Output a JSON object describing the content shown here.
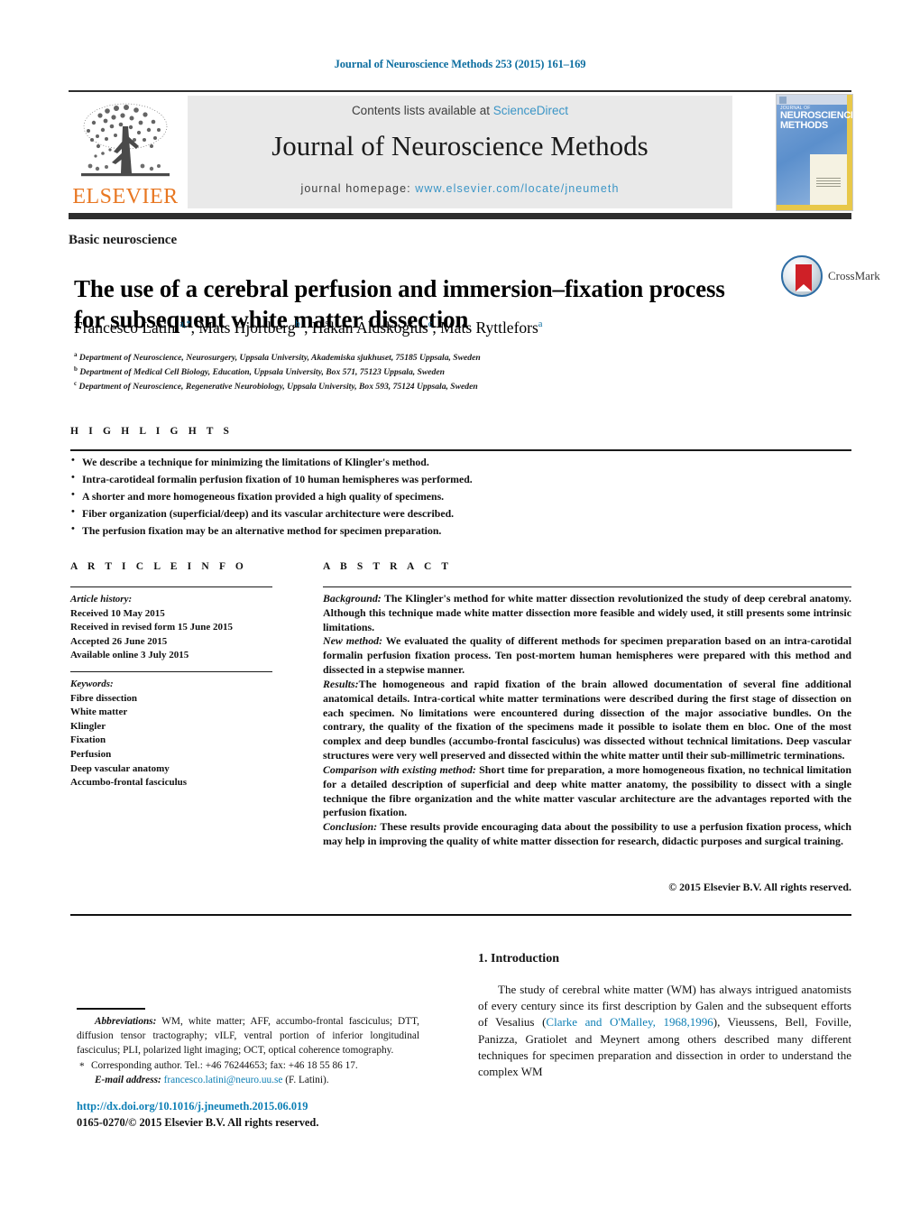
{
  "running_head": "Journal of Neuroscience Methods 253 (2015) 161–169",
  "masthead": {
    "contents_prefix": "Contents lists available at ",
    "sciencedirect": "ScienceDirect",
    "journal_title": "Journal of Neuroscience Methods",
    "homepage_prefix": "journal homepage: ",
    "homepage_url": "www.elsevier.com/locate/jneumeth",
    "publisher": "ELSEVIER",
    "cover": {
      "line1": "JOURNAL OF",
      "line2": "NEUROSCIENCE",
      "line3": "METHODS"
    }
  },
  "crossmark": {
    "label": "CrossMark"
  },
  "article": {
    "section_label": "Basic neuroscience",
    "title": "The use of a cerebral perfusion and immersion–fixation process for subsequent white matter dissection",
    "authors": [
      {
        "name": "Francesco Latini",
        "sup": "a,*"
      },
      {
        "name": "Mats Hjortberg",
        "sup": "b"
      },
      {
        "name": "Håkan Aldskogius",
        "sup": "c"
      },
      {
        "name": "Mats Ryttlefors",
        "sup": "a"
      }
    ],
    "affiliations": [
      {
        "marker": "a",
        "text": "Department of Neuroscience, Neurosurgery, Uppsala University, Akademiska sjukhuset, 75185 Uppsala, Sweden"
      },
      {
        "marker": "b",
        "text": "Department of Medical Cell Biology, Education, Uppsala University, Box 571, 75123 Uppsala, Sweden"
      },
      {
        "marker": "c",
        "text": "Department of Neuroscience, Regenerative Neurobiology, Uppsala University, Box 593, 75124 Uppsala, Sweden"
      }
    ]
  },
  "highlights": {
    "heading": "H I G H L I G H T S",
    "items": [
      "We describe a technique for minimizing the limitations of Klingler's method.",
      "Intra-carotideal formalin perfusion fixation of 10 human hemispheres was performed.",
      "A shorter and more homogeneous fixation provided a high quality of specimens.",
      "Fiber organization (superficial/deep) and its vascular architecture were described.",
      "The perfusion fixation may be an alternative method for specimen preparation."
    ]
  },
  "article_info": {
    "heading": "A R T I C L E    I N F O",
    "history_label": "Article history:",
    "history": [
      "Received 10 May 2015",
      "Received in revised form 15 June 2015",
      "Accepted 26 June 2015",
      "Available online 3 July 2015"
    ],
    "keywords_label": "Keywords:",
    "keywords": [
      "Fibre dissection",
      "White matter",
      "Klingler",
      "Fixation",
      "Perfusion",
      "Deep vascular anatomy",
      "Accumbo-frontal fasciculus"
    ]
  },
  "abstract": {
    "heading": "A B S T R A C T",
    "sections": [
      {
        "label": "Background:",
        "text": " The Klingler's method for white matter dissection revolutionized the study of deep cerebral anatomy. Although this technique made white matter dissection more feasible and widely used, it still presents some intrinsic limitations."
      },
      {
        "label": "New method:",
        "text": " We evaluated the quality of different methods for specimen preparation based on an intra-carotidal formalin perfusion fixation process. Ten post-mortem human hemispheres were prepared with this method and dissected in a stepwise manner."
      },
      {
        "label": "Results:",
        "text": "The homogeneous and rapid fixation of the brain allowed documentation of several fine additional anatomical details. Intra-cortical white matter terminations were described during the first stage of dissection on each specimen. No limitations were encountered during dissection of the major associative bundles. On the contrary, the quality of the fixation of the specimens made it possible to isolate them en bloc. One of the most complex and deep bundles (accumbo-frontal fasciculus) was dissected without technical limitations. Deep vascular structures were very well preserved and dissected within the white matter until their sub-millimetric terminations."
      },
      {
        "label": "Comparison with existing method:",
        "text": " Short time for preparation, a more homogeneous fixation, no technical limitation for a detailed description of superficial and deep white matter anatomy, the possibility to dissect with a single technique the fibre organization and the white matter vascular architecture are the advantages reported with the perfusion fixation."
      },
      {
        "label": "Conclusion:",
        "text": " These results provide encouraging data about the possibility to use a perfusion fixation process, which may help in improving the quality of white matter dissection for research, didactic purposes and surgical training."
      }
    ],
    "copyright": "© 2015 Elsevier B.V. All rights reserved."
  },
  "introduction": {
    "heading": "1.  Introduction",
    "paragraph_part1": "The study of cerebral white matter (WM) has always intrigued anatomists of every century since its first description by Galen and the subsequent efforts of Vesalius (",
    "citation": "Clarke and O'Malley, 1968,1996",
    "paragraph_part2": "), Vieussens, Bell, Foville, Panizza, Gratiolet and Meynert among others described many different techniques for specimen preparation and dissection in order to understand the complex WM"
  },
  "footnotes": {
    "abbrev_label": "Abbreviations:",
    "abbrev_text": "  WM, white matter; AFF, accumbo-frontal fasciculus; DTT, diffusion tensor tractography; vILF, ventral portion of inferior longitudinal fasciculus; PLI, polarized light imaging; OCT, optical coherence tomography.",
    "corresponding_star": "*",
    "corresponding_text": "Corresponding author. Tel.: +46 76244653; fax: +46 18 55 86 17.",
    "email_label": "E-mail address:",
    "email": "francesco.latini@neuro.uu.se",
    "email_suffix": " (F. Latini).",
    "doi": "http://dx.doi.org/10.1016/j.jneumeth.2015.06.019",
    "issn": "0165-0270/© 2015 Elsevier B.V. All rights reserved."
  },
  "colors": {
    "link_blue": "#0d7fb5",
    "masthead_blue": "#3b95c6",
    "elsevier_orange": "#E87722",
    "crossmark_red": "#cf2027"
  }
}
